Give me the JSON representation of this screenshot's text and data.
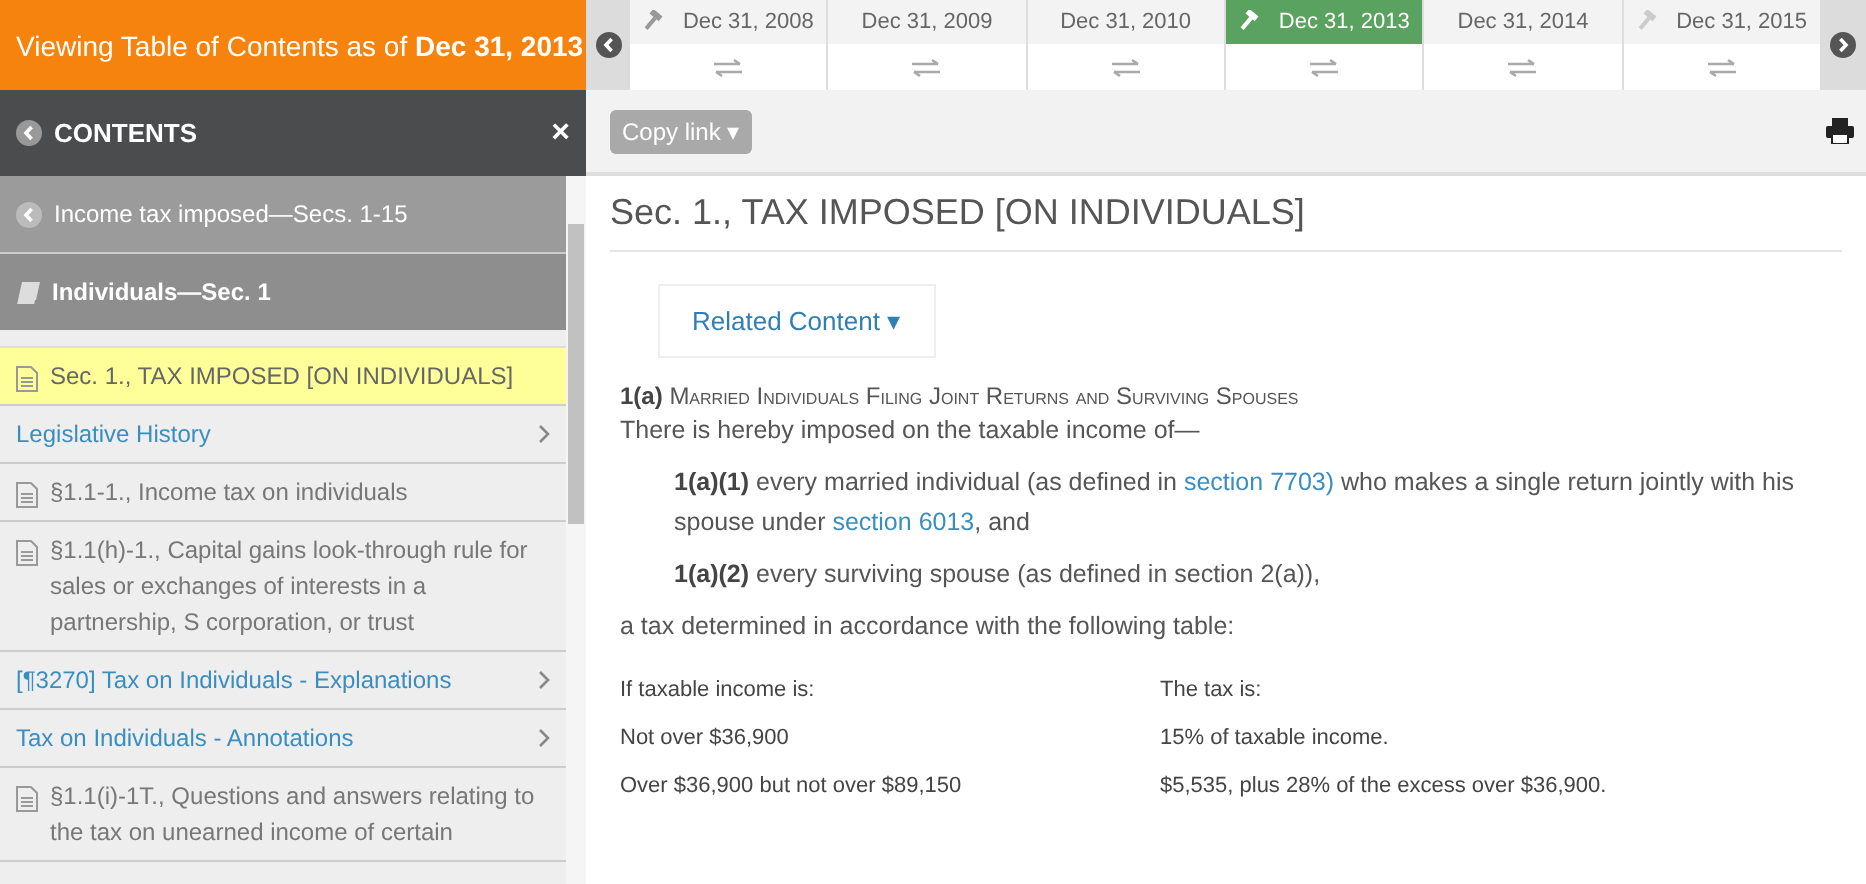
{
  "banner": {
    "prefix": "Viewing Table of Contents as of ",
    "date": "Dec 31, 2013"
  },
  "timeline": [
    {
      "date": "Dec 31, 2008",
      "selected": false,
      "marked": true
    },
    {
      "date": "Dec 31, 2009",
      "selected": false,
      "marked": false
    },
    {
      "date": "Dec 31, 2010",
      "selected": false,
      "marked": false
    },
    {
      "date": "Dec 31, 2013",
      "selected": true,
      "marked": true
    },
    {
      "date": "Dec 31, 2014",
      "selected": false,
      "marked": false
    },
    {
      "date": "Dec 31, 2015",
      "selected": false,
      "marked": true
    }
  ],
  "contents": {
    "title": "CONTENTS",
    "close": "×",
    "items": [
      {
        "kind": "parent",
        "text": "Income tax imposed—Secs. 1-15"
      },
      {
        "kind": "current",
        "text": "Individuals—Sec. 1"
      },
      {
        "kind": "doc",
        "text": "Sec. 1., TAX IMPOSED [ON INDIVIDUALS]",
        "selected": true
      },
      {
        "kind": "link",
        "text": "Legislative History"
      },
      {
        "kind": "doc",
        "text": "§1.1-1., Income tax on individuals",
        "selected": false
      },
      {
        "kind": "doc",
        "text": "§1.1(h)-1., Capital gains look-through rule for sales or exchanges of interests in a partnership, S corporation, or trust",
        "selected": false
      },
      {
        "kind": "link",
        "text": "[¶3270] Tax on Individuals - Explanations"
      },
      {
        "kind": "link",
        "text": "Tax on Individuals - Annotations"
      },
      {
        "kind": "doc",
        "text": "§1.1(i)-1T., Questions and answers relating to the tax on unearned income of certain",
        "selected": false
      }
    ]
  },
  "toolbar": {
    "copy_link": "Copy link",
    "caret": "▾"
  },
  "document": {
    "title": "Sec. 1., TAX IMPOSED [ON INDIVIDUALS]",
    "related": "Related Content",
    "related_caret": "▾",
    "heading": {
      "label": "1(a)",
      "title": "Married Individuals Filing Joint Returns and Surviving Spouses"
    },
    "paragraphs": [
      {
        "indent": false,
        "parts": [
          {
            "kind": "text",
            "text": "There is hereby imposed on the taxable income of—"
          }
        ]
      },
      {
        "indent": true,
        "parts": [
          {
            "kind": "bold",
            "text": "1(a)(1)"
          },
          {
            "kind": "text",
            "text": " every married individual (as defined in "
          },
          {
            "kind": "link",
            "text": "section 7703)"
          },
          {
            "kind": "text",
            "text": " who makes a single return jointly with his spouse under "
          },
          {
            "kind": "link",
            "text": "section 6013"
          },
          {
            "kind": "text",
            "text": ", and"
          }
        ]
      },
      {
        "indent": true,
        "parts": [
          {
            "kind": "bold",
            "text": "1(a)(2)"
          },
          {
            "kind": "text",
            "text": " every surviving spouse (as defined in section 2(a)),"
          }
        ]
      },
      {
        "indent": false,
        "parts": [
          {
            "kind": "text",
            "text": "a tax determined in accordance with the following table:"
          }
        ]
      }
    ],
    "table": {
      "columns": [
        "If taxable income is:",
        "The tax is:"
      ],
      "rows": [
        [
          "Not over $36,900",
          "15% of taxable income."
        ],
        [
          "Over $36,900 but not over $89,150",
          "$5,535, plus 28% of the excess over $36,900."
        ]
      ]
    }
  }
}
